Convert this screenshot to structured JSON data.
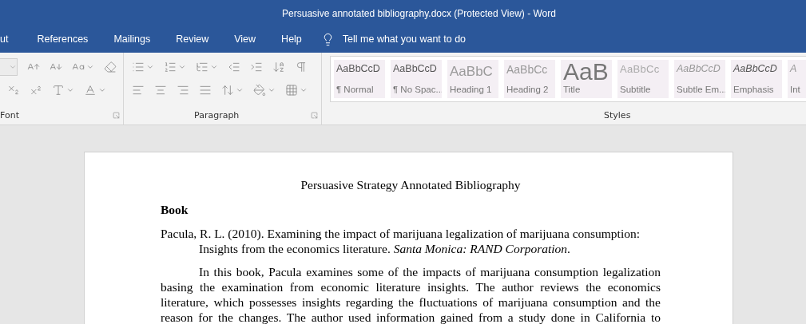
{
  "window": {
    "title": "Persuasive annotated bibliography.docx (Protected View)  -  Word"
  },
  "tabs": [
    {
      "label": "ut",
      "selected": false
    },
    {
      "label": "References",
      "selected": false
    },
    {
      "label": "Mailings",
      "selected": false
    },
    {
      "label": "Review",
      "selected": false
    },
    {
      "label": "View",
      "selected": false
    },
    {
      "label": "Help",
      "selected": false
    }
  ],
  "tell_me": {
    "placeholder": "Tell me what you want to do"
  },
  "ribbon": {
    "groups": [
      {
        "label": "Font"
      },
      {
        "label": "Paragraph"
      },
      {
        "label": "Styles"
      }
    ],
    "styles": [
      {
        "sample": "AaBbCcD",
        "label": "¶ Normal",
        "kind": "normal"
      },
      {
        "sample": "AaBbCcD",
        "label": "¶ No Spac...",
        "kind": "normal"
      },
      {
        "sample": "AaBbC",
        "label": "Heading 1",
        "kind": "heading1"
      },
      {
        "sample": "AaBbCc",
        "label": "Heading 2",
        "kind": "heading2"
      },
      {
        "sample": "AaB",
        "label": "Title",
        "kind": "title"
      },
      {
        "sample": "AaBbCc",
        "label": "Subtitle",
        "kind": "subtitle"
      },
      {
        "sample": "AaBbCcD",
        "label": "Subtle Em...",
        "kind": "subtle"
      },
      {
        "sample": "AaBbCcD",
        "label": "Emphasis",
        "kind": "emphasis"
      },
      {
        "sample": "A",
        "label": "Int",
        "kind": "subtle"
      }
    ]
  },
  "document": {
    "title": "Persuasive Strategy Annotated Bibliography",
    "heading": "Book",
    "citation": "Pacula, R. L. (2010). Examining the impact of marijuana legalization of marijuana consumption: Insights from the economics literature. *Santa Monica: RAND Corporation*.",
    "paragraph": "In this book, Pacula examines some of the impacts of marijuana consumption legalization basing the examination from economic literature insights. The author reviews the economics literature, which possesses insights regarding the fluctuations of marijuana consumption and the reason for the changes. The author used information gained from a study done in California to"
  }
}
